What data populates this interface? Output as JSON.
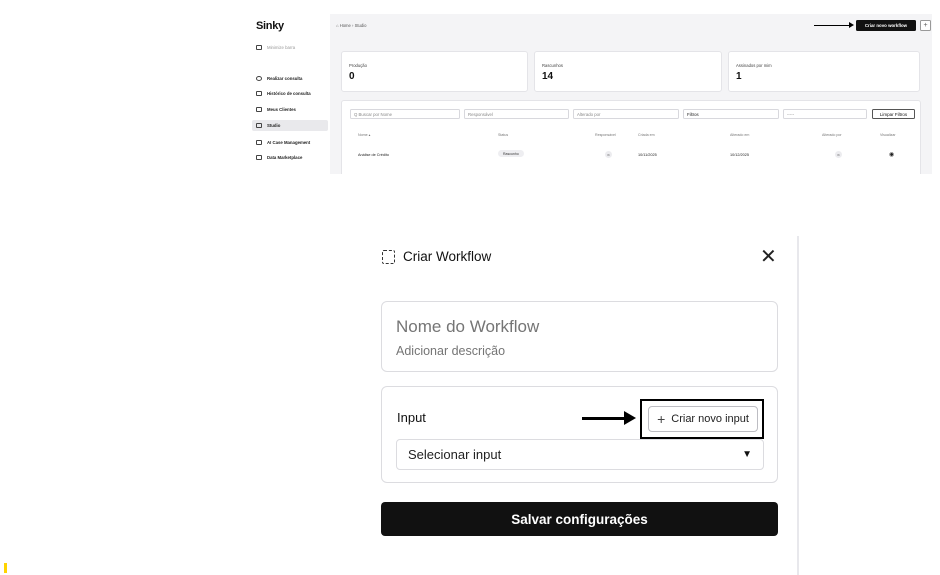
{
  "top": {
    "logo": "Sinky",
    "sidebar": {
      "items": [
        {
          "label": "Minimize barra",
          "icon": "panel-icon"
        },
        {
          "label": "Realizar consulta",
          "icon": "search-icon"
        },
        {
          "label": "Histórico de consulta",
          "icon": "history-icon"
        },
        {
          "label": "Meus Clientes",
          "icon": "folder-icon"
        },
        {
          "label": "Studio",
          "icon": "studio-icon"
        },
        {
          "label": "AI Case Management",
          "icon": "list-icon"
        },
        {
          "label": "Data Marketplace",
          "icon": "market-icon"
        }
      ]
    },
    "breadcrumb": "⌂ Home  ›  Studio",
    "new_workflow_button": "Criar novo workflow",
    "plus_button": "+",
    "stats": [
      {
        "label": "Produção",
        "value": "0"
      },
      {
        "label": "Rascunhos",
        "value": "14"
      },
      {
        "label": "Assinados por mim",
        "value": "1"
      }
    ],
    "filters": {
      "search_placeholder": "Q  Buscar por Nome",
      "responsavel": "Responsável",
      "alterado_por": "Alterado por",
      "filtros": "Filtros",
      "date_placeholder": "-----",
      "clear_button": "Limpar Filtros"
    },
    "table": {
      "headers": [
        "Nome ▴",
        "Status",
        "Responsável",
        "Criada em",
        "Alterado em",
        "Alterado por",
        "Visualizar"
      ],
      "rows": [
        {
          "nome": "Análise de Crédito",
          "status": "Rascunho",
          "responsavel": "IK",
          "criada": "10/11/2025",
          "alterado": "10/12/2025",
          "alterado_por": "IK"
        }
      ]
    }
  },
  "modal": {
    "title": "Criar Workflow",
    "close": "✕",
    "name_placeholder": "Nome do Workflow",
    "description_placeholder": "Adicionar descrição",
    "input_label": "Input",
    "add_input_button": "Criar novo input",
    "select_input": "Selecionar input",
    "save_button": "Salvar configurações"
  }
}
